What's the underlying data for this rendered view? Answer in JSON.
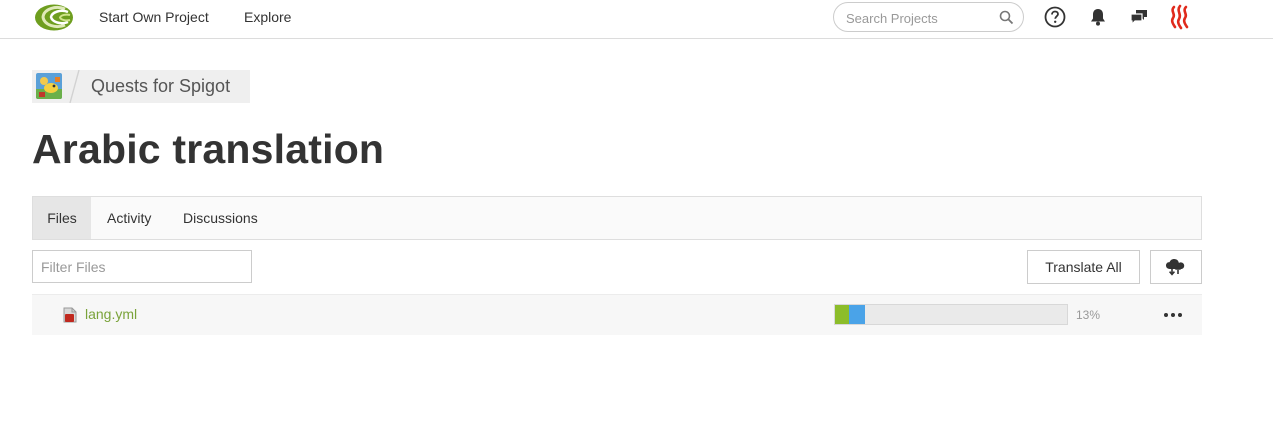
{
  "nav": {
    "start_project": "Start Own Project",
    "explore": "Explore"
  },
  "search": {
    "placeholder": "Search Projects"
  },
  "icons": {
    "logo": "crowdin-logo",
    "search": "search-icon",
    "help": "help-icon",
    "notifications": "bell-icon",
    "messages": "chat-icon",
    "steem": "steem-icon",
    "file": "file-icon",
    "download": "cloud-download-icon",
    "more": "more-icon"
  },
  "breadcrumb": {
    "project": "Quests for Spigot"
  },
  "page": {
    "title": "Arabic translation"
  },
  "tabs": [
    {
      "label": "Files",
      "active": true
    },
    {
      "label": "Activity",
      "active": false
    },
    {
      "label": "Discussions",
      "active": false
    }
  ],
  "toolbar": {
    "filter_placeholder": "Filter Files",
    "translate_all": "Translate All"
  },
  "files": [
    {
      "name": "lang.yml",
      "translated_percent": "13%",
      "approved_fraction": 0.06,
      "translated_fraction": 0.13
    }
  ],
  "colors": {
    "approved": "#8cbd2a",
    "translated": "#4aa3e8",
    "file_link": "#7aa33a",
    "steem": "#e02a1c"
  }
}
